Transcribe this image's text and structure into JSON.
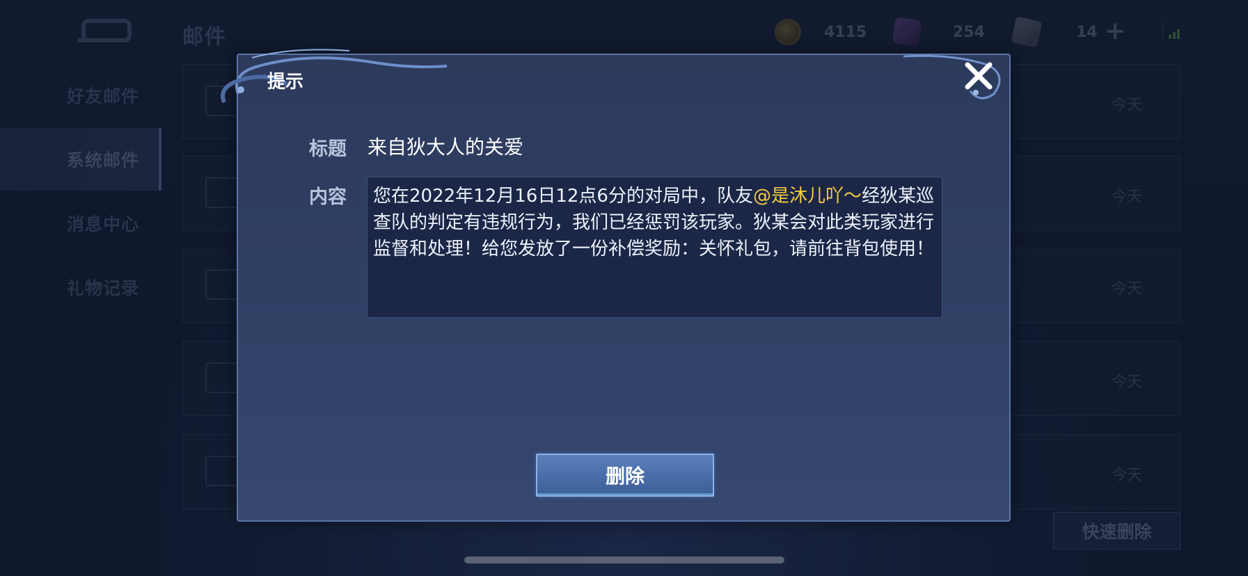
{
  "header": {
    "title": "邮件",
    "currencies": [
      {
        "icon": "coin-icon",
        "value": "4115"
      },
      {
        "icon": "gem-icon",
        "value": "254"
      },
      {
        "icon": "card-icon",
        "value": "14"
      }
    ]
  },
  "sidebar": {
    "items": [
      {
        "label": "好友邮件",
        "active": false
      },
      {
        "label": "系统邮件",
        "active": true
      },
      {
        "label": "消息中心",
        "active": false
      },
      {
        "label": "礼物记录",
        "active": false
      }
    ]
  },
  "mail_list": {
    "rows": [
      {
        "date": "今天"
      },
      {
        "date": "今天"
      },
      {
        "date": "今天"
      },
      {
        "date": "今天"
      },
      {
        "date": "今天"
      }
    ],
    "quick_delete_label": "快速删除"
  },
  "dialog": {
    "title": "提示",
    "subject_label": "标题",
    "subject_value": "来自狄大人的关爱",
    "content_label": "内容",
    "content_before": "您在2022年12月16日12点6分的对局中，队友",
    "content_mention": "@是沐儿吖～",
    "content_after": "经狄某巡查队的判定有违规行为，我们已经惩罚该玩家。狄某会对此类玩家进行监督和处理！给您发放了一份补偿奖励：关怀礼包，请前往背包使用！",
    "delete_label": "删除"
  },
  "colors": {
    "mention": "#f3cd3b",
    "dialog_border": "#5a74a6",
    "button": "#4a6ea9"
  }
}
